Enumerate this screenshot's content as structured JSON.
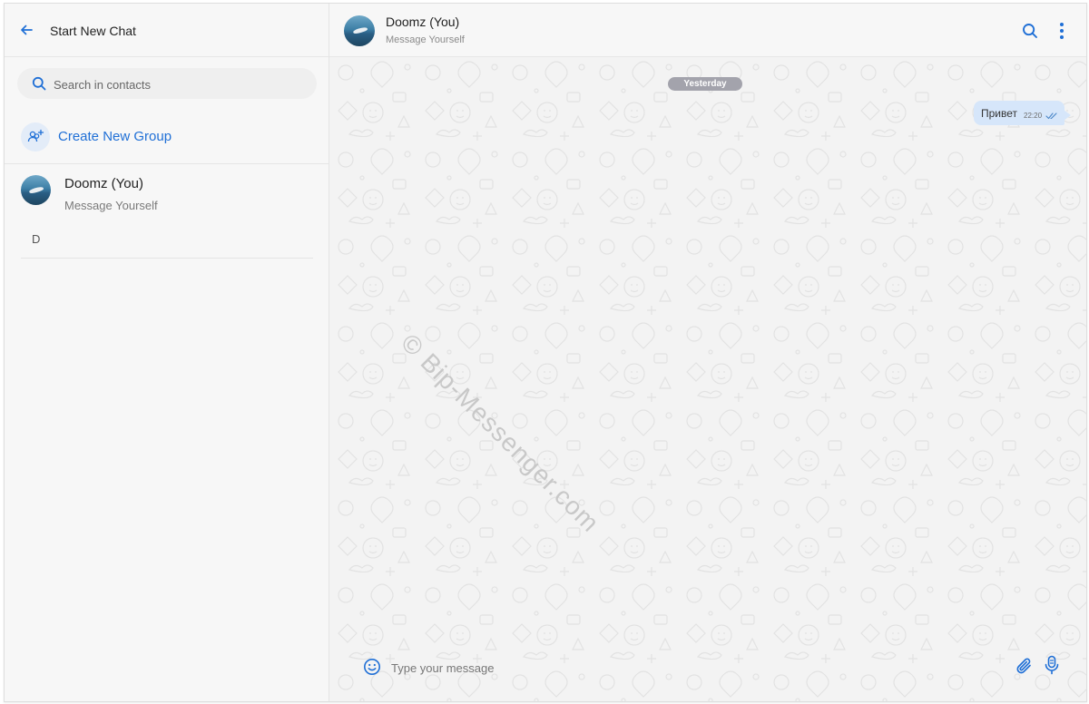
{
  "sidebar": {
    "title": "Start New Chat",
    "search_placeholder": "Search in contacts",
    "create_group_label": "Create New Group",
    "contacts": [
      {
        "name": "Doomz (You)",
        "status": "Message Yourself"
      }
    ],
    "section_letter": "D"
  },
  "chat": {
    "name": "Doomz (You)",
    "status": "Message Yourself",
    "date_separator": "Yesterday",
    "messages": [
      {
        "text": "Привет",
        "time": "22:20",
        "direction": "outgoing",
        "read": true
      }
    ],
    "watermark": "© Bip-Messenger.com",
    "input_placeholder": "Type your message"
  },
  "colors": {
    "accent": "#1f6fd6",
    "bubble_outgoing": "#d6e6fa",
    "date_pill": "#a3a3ac"
  },
  "icons": {
    "back": "arrow-left-icon",
    "search": "search-icon",
    "create_group": "group-add-icon",
    "menu": "more-vertical-icon",
    "emoji": "emoji-icon",
    "attach": "paperclip-icon",
    "mic": "microphone-icon",
    "read_receipt": "double-check-icon"
  }
}
